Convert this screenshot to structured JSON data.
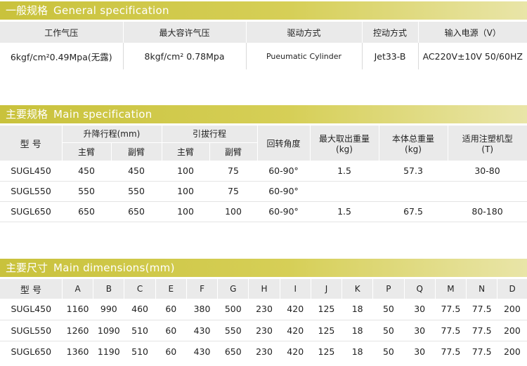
{
  "general": {
    "title_cn": "一般规格",
    "title_en": "General specification",
    "headers": [
      "工作气压",
      "最大容许气压",
      "驱动方式",
      "控动方式",
      "输入电源（V）"
    ],
    "values": [
      "6kgf/cm²0.49Mpa(无露)",
      "8kgf/cm² 0.78Mpa",
      "Pueumatic Cylinder",
      "Jet33-B",
      "AC220V±10V 50/60HZ"
    ]
  },
  "main": {
    "title_cn": "主要规格",
    "title_en": "Main specification",
    "headers": {
      "model": "型 号",
      "lift": "升降行程(mm)",
      "pull": "引拔行程",
      "main_arm": "主臂",
      "sub_arm": "副臂",
      "rotation": "回转角度",
      "max_load": "最大取出重量",
      "max_load_unit": "(kg)",
      "weight": "本体总重量",
      "weight_unit": "(kg)",
      "machine": "适用注塑机型",
      "machine_unit": "(T)"
    },
    "rows": [
      {
        "model": "SUGL450",
        "lift_main": "450",
        "lift_sub": "450",
        "pull_main": "100",
        "pull_sub": "75",
        "rotation": "60-90°",
        "max_load": "1.5",
        "weight": "57.3",
        "machine": "30-80"
      },
      {
        "model": "SUGL550",
        "lift_main": "550",
        "lift_sub": "550",
        "pull_main": "100",
        "pull_sub": "75",
        "rotation": "60-90°",
        "max_load": "",
        "weight": "",
        "machine": ""
      },
      {
        "model": "SUGL650",
        "lift_main": "650",
        "lift_sub": "650",
        "pull_main": "100",
        "pull_sub": "100",
        "rotation": "60-90°",
        "max_load": "1.5",
        "weight": "67.5",
        "machine": "80-180"
      }
    ]
  },
  "dims": {
    "title_cn": "主要尺寸",
    "title_en": "Main dimensions(mm)",
    "headers": [
      "型 号",
      "A",
      "B",
      "C",
      "E",
      "F",
      "G",
      "H",
      "I",
      "J",
      "K",
      "P",
      "Q",
      "M",
      "N",
      "D"
    ],
    "rows": [
      [
        "SUGL450",
        "1160",
        "990",
        "460",
        "60",
        "380",
        "500",
        "230",
        "420",
        "125",
        "18",
        "50",
        "30",
        "77.5",
        "77.5",
        "200"
      ],
      [
        "SUGL550",
        "1260",
        "1090",
        "510",
        "60",
        "430",
        "550",
        "230",
        "420",
        "125",
        "18",
        "50",
        "30",
        "77.5",
        "77.5",
        "200"
      ],
      [
        "SUGL650",
        "1360",
        "1190",
        "510",
        "60",
        "430",
        "650",
        "230",
        "420",
        "125",
        "18",
        "50",
        "30",
        "77.5",
        "77.5",
        "200"
      ]
    ]
  }
}
